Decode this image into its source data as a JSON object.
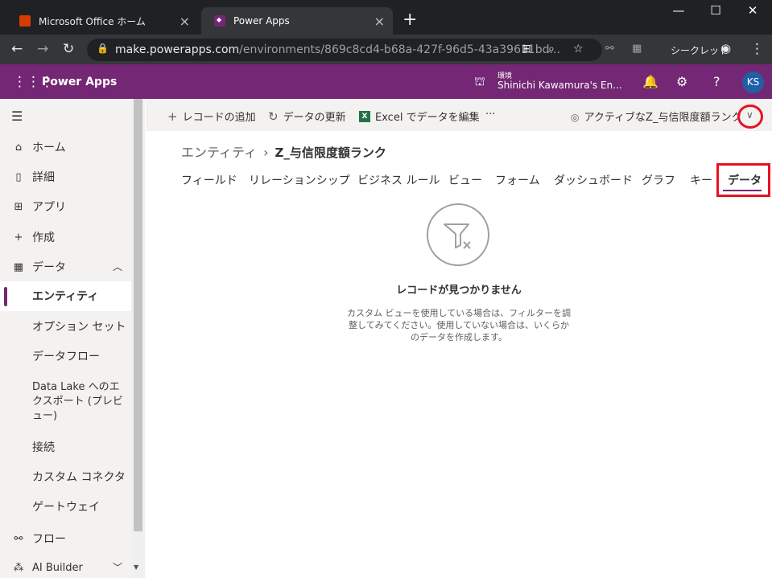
{
  "browser": {
    "tabs": [
      {
        "title": "Microsoft Office ホーム",
        "favicon": "office-icon"
      },
      {
        "title": "Power Apps",
        "favicon": "power-apps-icon"
      }
    ],
    "url_host": "make.powerapps.com",
    "url_path": "/environments/869c8cd4-b68a-427f-96d5-43a39611bd...",
    "incognito_label": "シークレット"
  },
  "header": {
    "app_title": "Power Apps",
    "env_label": "環境",
    "env_name": "Shinichi Kawamura's En...",
    "avatar_initials": "KS"
  },
  "sidebar": {
    "items": [
      {
        "label": "ホーム",
        "icon": "home-icon"
      },
      {
        "label": "詳細",
        "icon": "book-icon"
      },
      {
        "label": "アプリ",
        "icon": "apps-icon"
      },
      {
        "label": "作成",
        "icon": "plus-icon"
      },
      {
        "label": "データ",
        "icon": "table-icon"
      }
    ],
    "sub_items": [
      "エンティティ",
      "オプション セット",
      "データフロー",
      "Data Lake へのエクスポート (プレビュー)",
      "接続",
      "カスタム コネクタ",
      "ゲートウェイ"
    ],
    "bottom_items": [
      {
        "label": "フロー",
        "icon": "flow-icon"
      },
      {
        "label": "AI Builder",
        "icon": "ai-icon"
      }
    ]
  },
  "commands": {
    "add_record": "レコードの追加",
    "refresh": "データの更新",
    "edit_excel": "Excel でデータを編集",
    "more": "···",
    "view_selector": "アクティブなZ_与信限度額ランク"
  },
  "breadcrumb": {
    "parent": "エンティティ",
    "separator": "›",
    "current": "Z_与信限度額ランク"
  },
  "page_tabs": [
    "フィールド",
    "リレーションシップ",
    "ビジネス ルール",
    "ビュー",
    "フォーム",
    "ダッシュボード",
    "グラフ",
    "キー",
    "データ"
  ],
  "empty_state": {
    "title": "レコードが見つかりません",
    "description": "カスタム ビューを使用している場合は、フィルターを調整してみてください。使用していない場合は、いくらかのデータを作成します。"
  },
  "colors": {
    "brand": "#742774",
    "highlight": "#e81123"
  }
}
